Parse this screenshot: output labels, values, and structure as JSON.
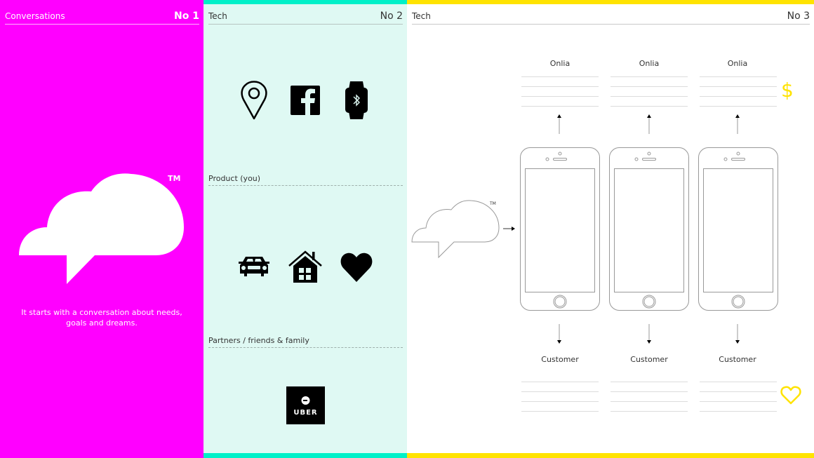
{
  "colors": {
    "magenta": "#ff00ff",
    "mint": "#dff9f3",
    "teal_accent": "#00f0c8",
    "yellow_accent": "#ffe300",
    "white": "#ffffff"
  },
  "panel1": {
    "title": "Conversations",
    "number": "No 1",
    "logo": "chat-cloud-icon",
    "trademark": "TM",
    "tagline": "It starts with a conversation about needs, goals and dreams."
  },
  "panel2": {
    "title": "Tech",
    "number": "No 2",
    "tech_icons": [
      "location-pin-icon",
      "facebook-icon",
      "smartwatch-bluetooth-icon"
    ],
    "product_label": "Product (you)",
    "product_icons": [
      "car-icon",
      "house-icon",
      "heart-icon"
    ],
    "partners_label": "Partners / friends & family",
    "partner_logo": {
      "icon": "uber-logo-icon",
      "text": "UBER"
    }
  },
  "panel3": {
    "title": "Tech",
    "number": "No 3",
    "trademark": "TM",
    "columns": [
      {
        "top_label": "Onlia",
        "bottom_label": "Customer"
      },
      {
        "top_label": "Onlia",
        "bottom_label": "Customer"
      },
      {
        "top_label": "Onlia",
        "bottom_label": "Customer"
      }
    ],
    "dollar_symbol": "$",
    "heart_icon": "heart-outline-icon"
  }
}
